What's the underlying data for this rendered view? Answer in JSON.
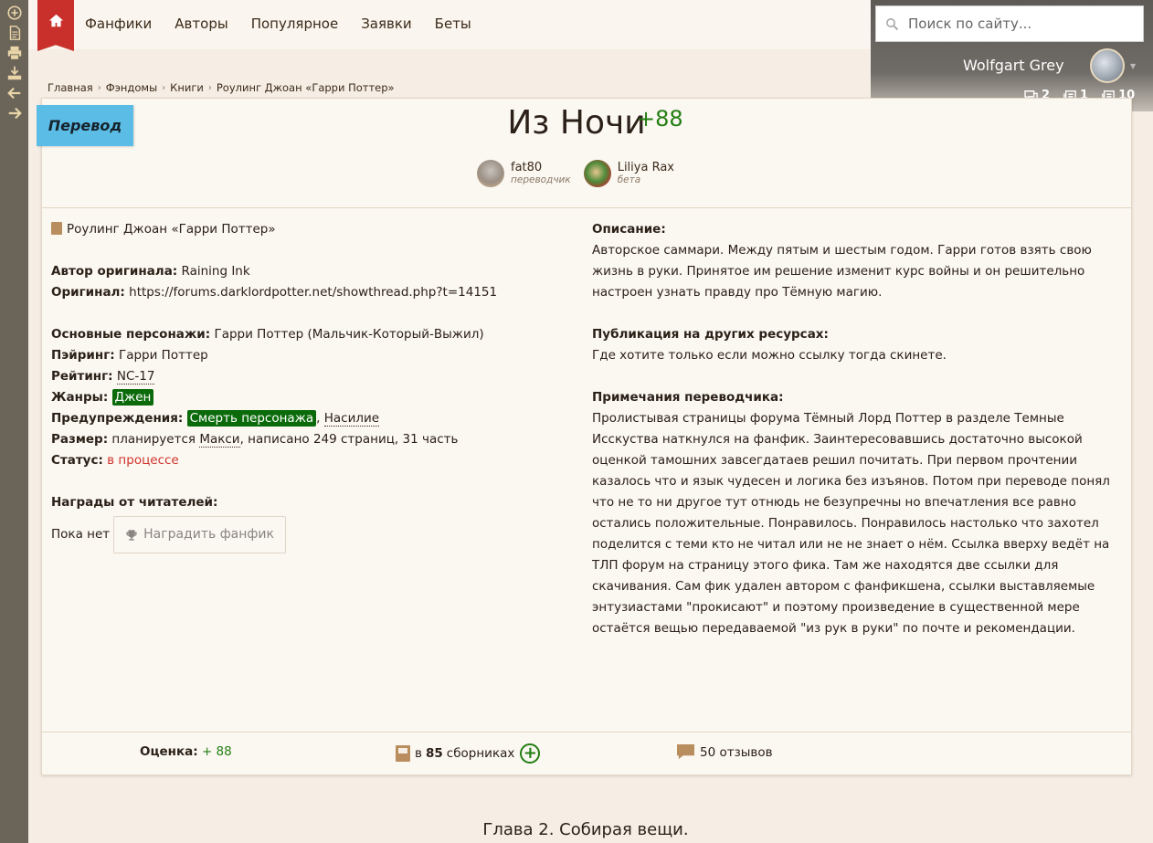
{
  "rail": {
    "icons": [
      "plus-circle-icon",
      "document-icon",
      "print-icon",
      "download-icon",
      "arrow-left-icon",
      "arrow-right-icon"
    ]
  },
  "nav": {
    "items": [
      "Фанфики",
      "Авторы",
      "Популярное",
      "Заявки",
      "Беты"
    ]
  },
  "search": {
    "placeholder": "Поиск по сайту..."
  },
  "user": {
    "name": "Wolfgart Grey",
    "counters": [
      "2",
      "1",
      "10"
    ]
  },
  "breadcrumb": [
    "Главная",
    "Фэндомы",
    "Книги",
    "Роулинг Джоан «Гарри Поттер»"
  ],
  "work": {
    "type": "Перевод",
    "title": "Из Ночи",
    "score": "+88",
    "people": [
      {
        "name": "fat80",
        "role": "переводчик"
      },
      {
        "name": "Liliya Rax",
        "role": "бета"
      }
    ]
  },
  "info": {
    "fandom": "Роулинг Джоан «Гарри Поттер»",
    "author_label": "Автор оригинала:",
    "author": "Raining Ink",
    "original_label": "Оригинал:",
    "original": "https://forums.darklordpotter.net/showthread.php?t=14151",
    "characters_label": "Основные персонажи:",
    "characters": "Гарри Поттер (Мальчик-Который-Выжил)",
    "pairing_label": "Пэйринг:",
    "pairing": "Гарри Поттер",
    "rating_label": "Рейтинг:",
    "rating": "NC-17",
    "genres_label": "Жанры:",
    "genre": "Джен",
    "warnings_label": "Предупреждения:",
    "warning1": "Смерть персонажа",
    "warning_sep": ",",
    "warning2": "Насилие",
    "size_label": "Размер:",
    "size_prefix": "планируется",
    "size_value": "Макси",
    "size_suffix": ", написано 249 страниц, 31 часть",
    "status_label": "Статус:",
    "status": "в процессе",
    "awards_label": "Награды от читателей:",
    "awards_none": "Пока нет",
    "award_button": "Наградить фанфик"
  },
  "desc": {
    "description_label": "Описание:",
    "description": "Авторское саммари. Между пятым и шестым годом. Гарри готов взять свою жизнь в руки. Принятое им решение изменит курс войны и он решительно настроен узнать правду про Тёмную магию.",
    "publication_label": "Публикация на других ресурсах:",
    "publication": "Где хотите только если можно ссылку тогда скинете.",
    "notes_label": "Примечания переводчика:",
    "notes": "Пролистывая страницы форума Тёмный Лорд Поттер в разделе Темные Исскуства наткнулся на фанфик. Заинтересовавшись достаточно высокой оценкой тамошних завсегдатаев решил почитать. При первом прочтении казалось что и язык чудесен и логика без изъянов. Потом при переводе понял что не то ни другое тут отнюдь не безупречны но впечатления все равно остались положительные. Понравилось. Понравилось настолько что захотел поделится с теми кто не читал или не не знает о нём. Ссылка вверху ведёт на ТЛП форум на страницу этого фика. Там же находятся две ссылки для скачивания. Сам фик удален автором с фанфикшена, ссылки выставляемые энтузиастами \"прокисают\" и поэтому произведение в существенной мере остаётся вещью передаваемой \"из рук в руки\" по почте и рекомендации."
  },
  "footer": {
    "rating_label": "Оценка:",
    "rating_value": "+ 88",
    "collections_prefix": "в",
    "collections_count": "85",
    "collections_suffix": "сборниках",
    "reviews": "50 отзывов"
  },
  "chapter": {
    "title": "Глава 2. Собирая вещи."
  },
  "colors": {
    "accent": "#c9302c",
    "ribbon": "#5bbce5",
    "score": "#237e12",
    "genre_tag": "#0b6b0b",
    "status": "#d0342c"
  }
}
